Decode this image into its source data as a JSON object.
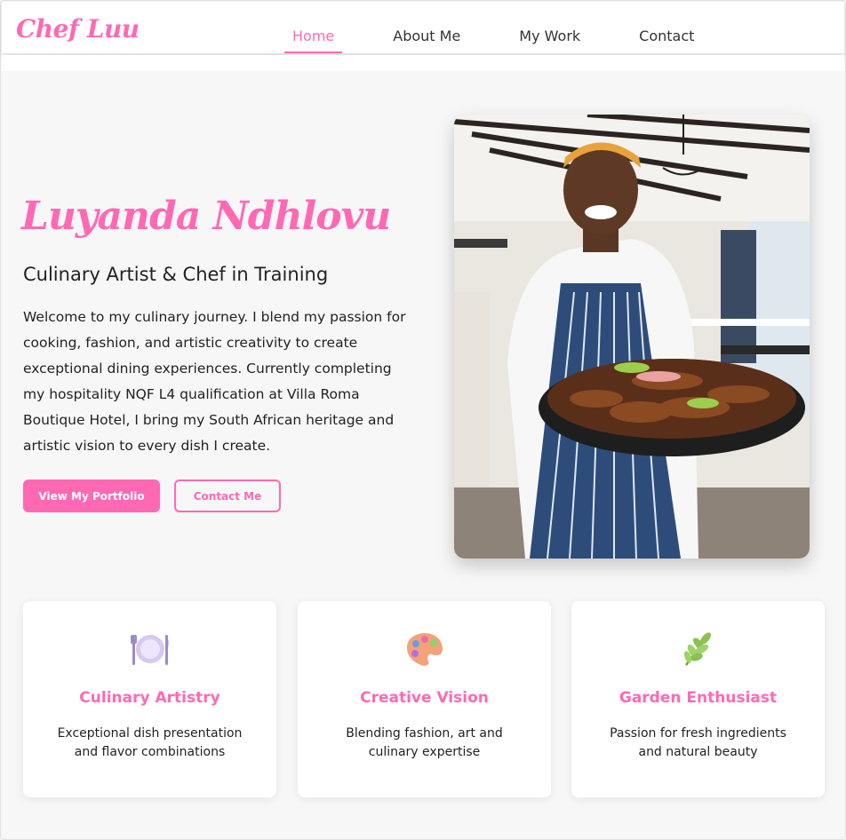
{
  "header": {
    "logo": "Chef Luu",
    "nav": [
      {
        "label": "Home",
        "active": true
      },
      {
        "label": "About Me",
        "active": false
      },
      {
        "label": "My Work",
        "active": false
      },
      {
        "label": "Contact",
        "active": false
      }
    ]
  },
  "hero": {
    "name": "Luyanda Ndhlovu",
    "subtitle": "Culinary Artist & Chef in Training",
    "description": "Welcome to my culinary journey. I blend my passion for cooking, fashion, and artistic creativity to create exceptional dining experiences. Currently completing my hospitality NQF L4 qualification at Villa Roma Boutique Hotel, I bring my South African heritage and artistic vision to every dish I create.",
    "primary_button": "View My Portfolio",
    "secondary_button": "Contact Me"
  },
  "cards": [
    {
      "icon": "plate-cutlery-icon",
      "title": "Culinary Artistry",
      "description": "Exceptional dish presentation and flavor combinations"
    },
    {
      "icon": "artist-palette-icon",
      "title": "Creative Vision",
      "description": "Blending fashion, art and culinary expertise"
    },
    {
      "icon": "herb-icon",
      "title": "Garden Enthusiast",
      "description": "Passion for fresh ingredients and natural beauty"
    }
  ],
  "colors": {
    "accent": "#ff69b4",
    "background": "#f7f7f7",
    "text": "#222222"
  }
}
